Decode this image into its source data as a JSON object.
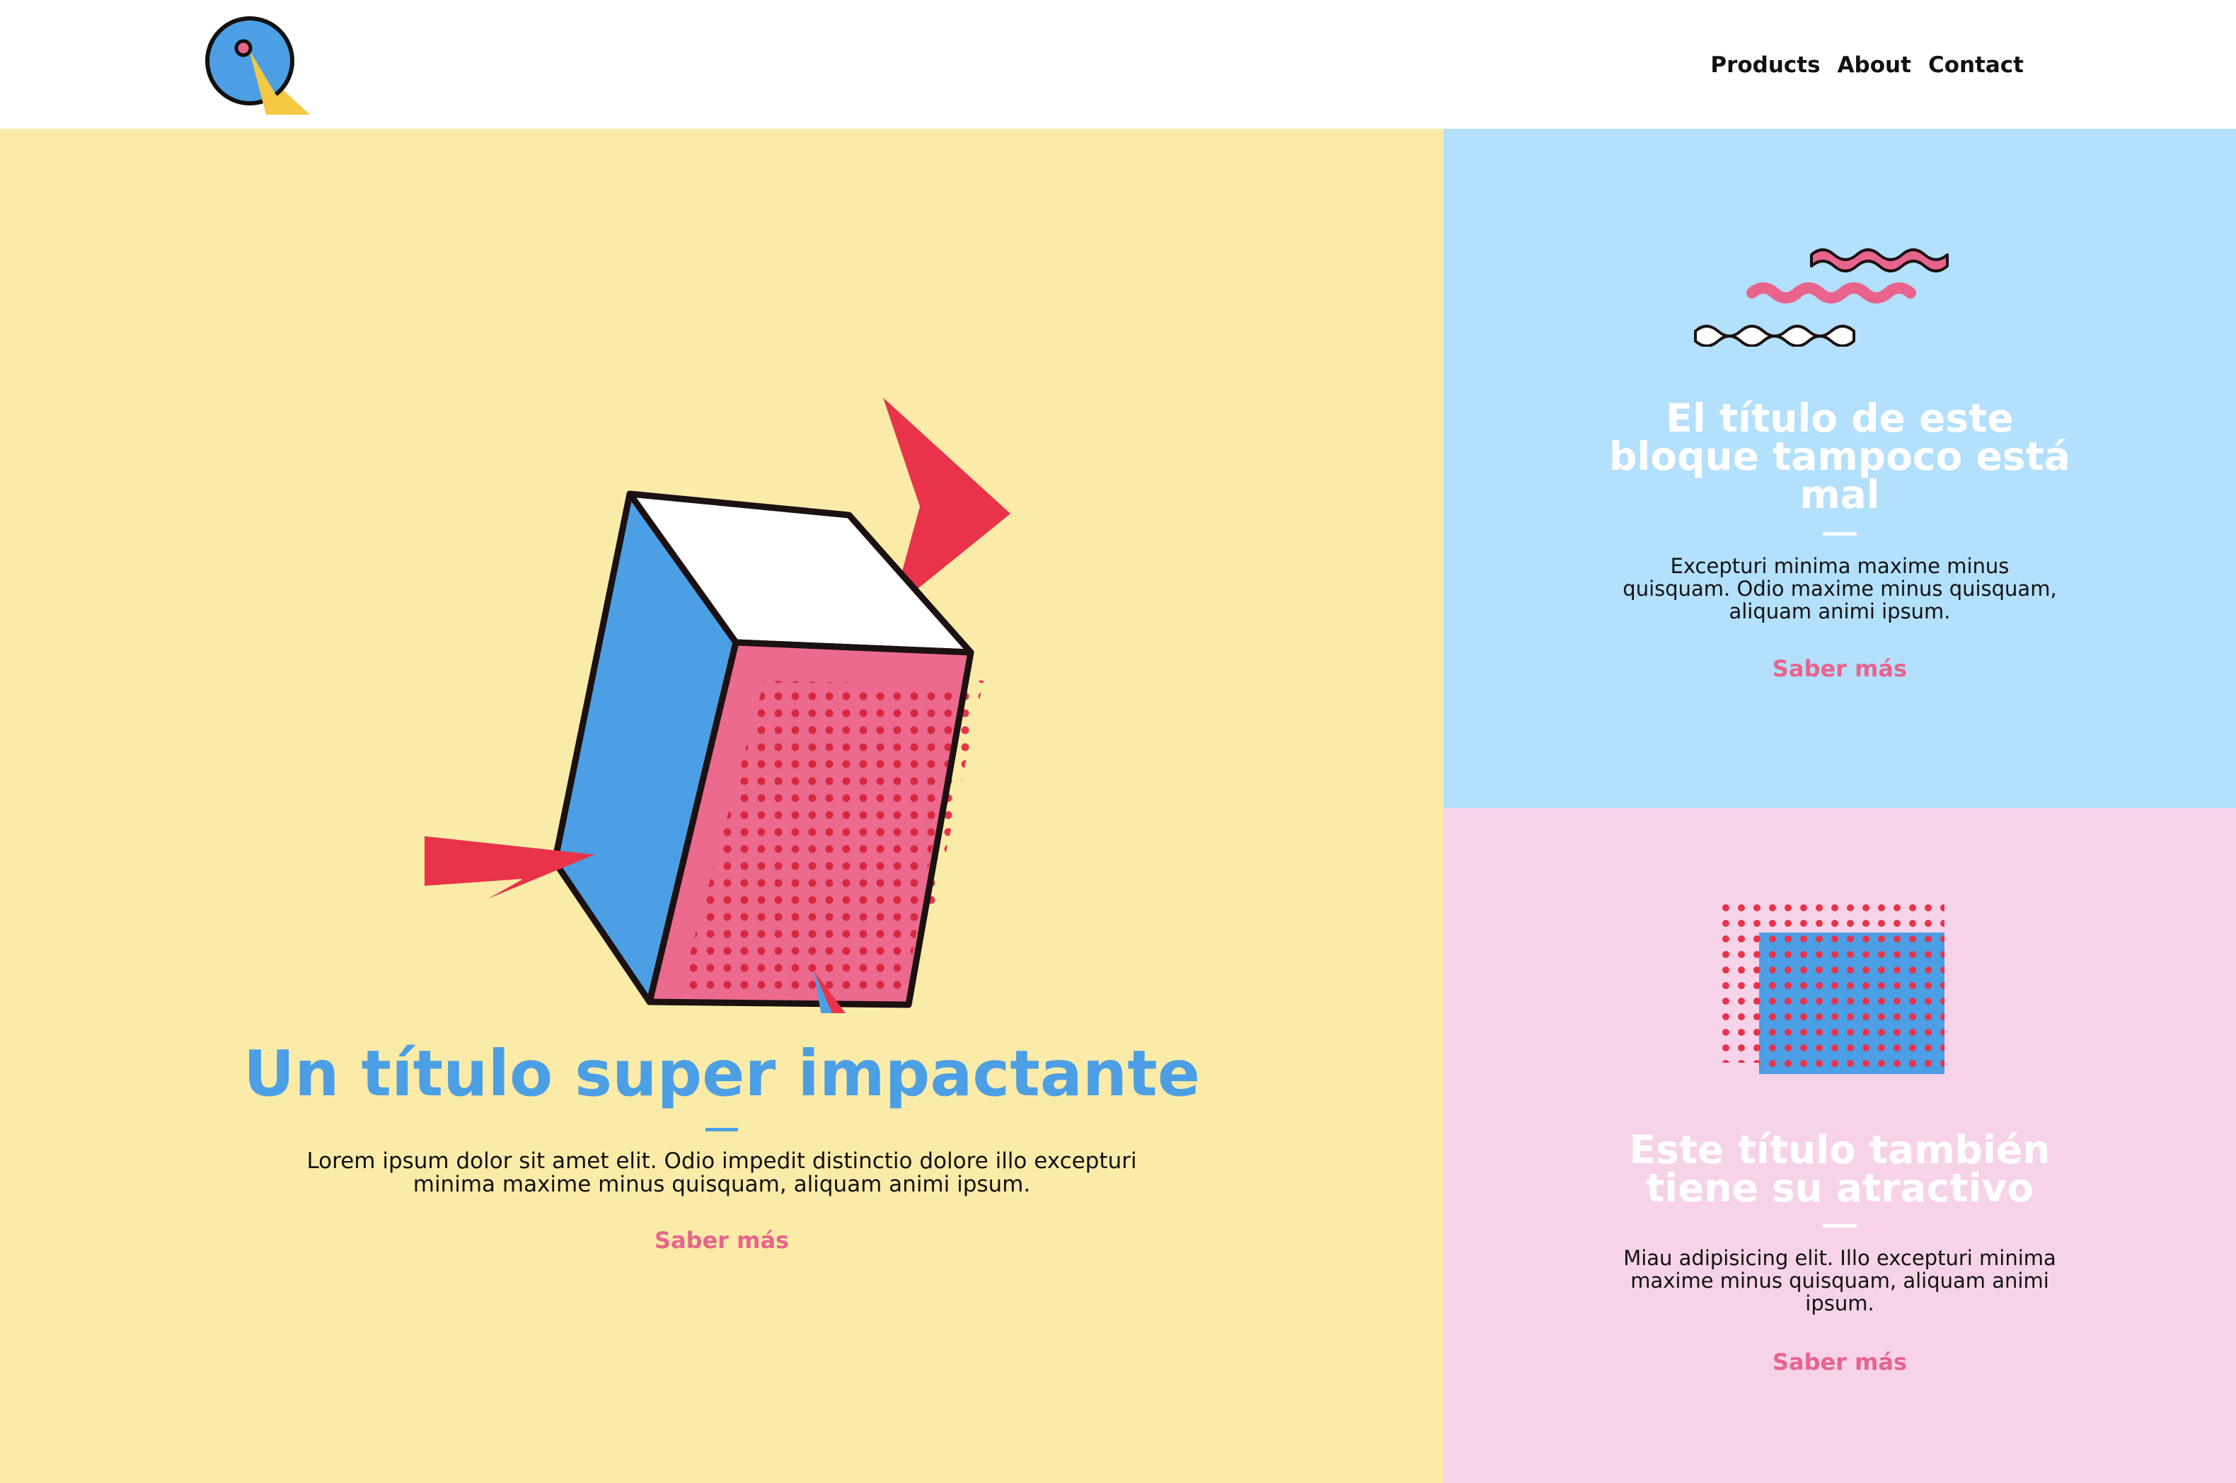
{
  "header": {
    "logo_icon": "q-gauge-logo",
    "nav": [
      "Products",
      "About",
      "Contact"
    ]
  },
  "hero": {
    "illustration": "isometric-cube-with-arrows",
    "title": "Un título super impactante",
    "text": "Lorem ipsum dolor sit amet elit. Odio impedit distinctio dolore illo excepturi minima maxime minus quisquam, aliquam animi ipsum.",
    "cta": "Saber más"
  },
  "card_blue": {
    "illustration": "zigzag-waves",
    "title": "El título de este bloque tampoco está mal",
    "text": "Excepturi minima maxime minus quisquam. Odio maxime minus quisquam, aliquam animi ipsum.",
    "cta": "Saber más"
  },
  "card_pink": {
    "illustration": "dotted-rectangles",
    "title": "Este título también tiene su atractivo",
    "text": "Miau adipisicing elit. Illo excepturi minima maxime minus quisquam, aliquam animi ipsum.",
    "cta": "Saber más"
  },
  "colors": {
    "hero_bg": "#fbeba8",
    "blue_card_bg": "#b3e0fc",
    "pink_card_bg": "#f6d3e9",
    "title_blue": "#4c9fe4",
    "cta_pink": "#e8648c",
    "accent_red": "#e8334a"
  }
}
